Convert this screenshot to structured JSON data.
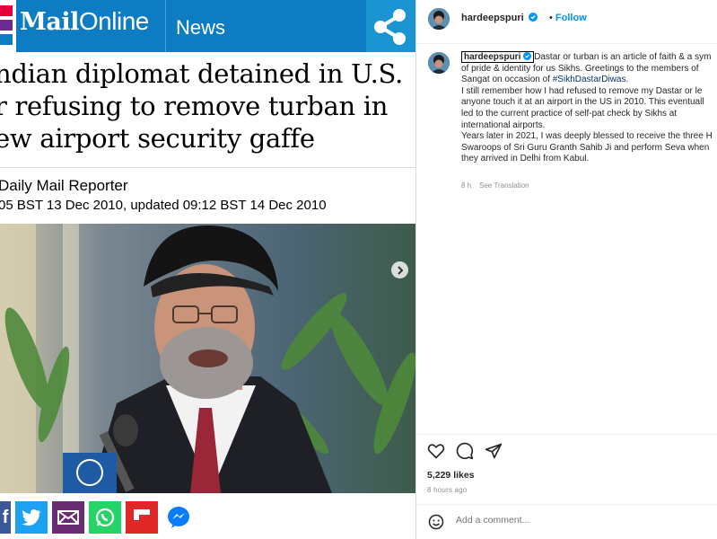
{
  "mail": {
    "logo_bold": "Mail",
    "logo_rest": "Online",
    "section": "News",
    "headline_lines": [
      "ndian diplomat detained in U.S.",
      "r refusing to remove turban in",
      "ew airport security gaffe"
    ],
    "byline": "Daily Mail Reporter",
    "dateline": "05 BST 13 Dec 2010, updated 09:12 BST 14 Dec 2010",
    "share_buttons": [
      "facebook",
      "twitter",
      "email",
      "whatsapp",
      "flipboard",
      "messenger"
    ],
    "colors": {
      "header": "#0d7cc2",
      "share": "#1a95d2"
    }
  },
  "instagram": {
    "username": "hardeepspuri",
    "follow_label": "Follow",
    "dot": "•",
    "caption_lines": [
      "Dastar or turban is an article of faith & a sym",
      "of pride & identity for us Sikhs. Greetings to the members of",
      "Sangat on occasion of"
    ],
    "hashtag": "#SikhDastarDiwas",
    "caption_rest": [
      "I still remember how I had refused to remove my Dastar or le",
      "anyone touch it at an airport in the US in 2010. This eventuall",
      "led to the current practice of self-pat check by Sikhs at",
      "international airports.",
      "Years later in 2021, I was deeply blessed to receive the three H",
      "Swaroops of Sri Guru Granth Sahib Ji and perform Seva when",
      "they arrived in Delhi from Kabul."
    ],
    "caption_age": "8 h",
    "see_translation": "See Translation",
    "likes": "5,229 likes",
    "time_ago": "8 hours ago",
    "comment_placeholder": "Add a comment...",
    "colors": {
      "link": "#0095f6",
      "verified": "#0095f6"
    }
  }
}
